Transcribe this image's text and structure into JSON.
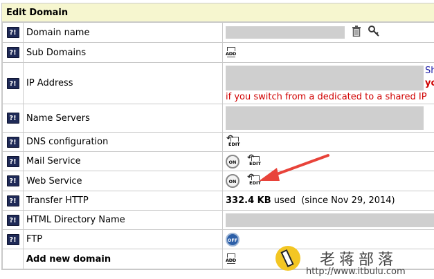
{
  "panel": {
    "title": "Edit Domain"
  },
  "help_label": "?!",
  "rows": {
    "domain_name": {
      "label": "Domain name"
    },
    "sub_domains": {
      "label": "Sub Domains",
      "icon_text": "ADD"
    },
    "ip_address": {
      "label": "IP Address",
      "side_text_1": "Sha",
      "side_text_2": "you",
      "warning": "if you switch from a dedicated to a shared IP"
    },
    "name_servers": {
      "label": "Name Servers"
    },
    "dns": {
      "label": "DNS configuration",
      "icon_text": "EDIT"
    },
    "mail": {
      "label": "Mail Service",
      "toggle": "ON",
      "icon_text": "EDIT"
    },
    "web": {
      "label": "Web Service",
      "toggle": "ON",
      "icon_text": "EDIT"
    },
    "transfer": {
      "label": "Transfer HTTP",
      "amount": "332.4 KB",
      "used": "used",
      "since": "(since Nov 29, 2014)"
    },
    "html_dir": {
      "label": "HTML Directory Name"
    },
    "ftp": {
      "label": "FTP",
      "toggle": "OFF"
    },
    "add_domain": {
      "label": "Add new domain",
      "icon_text": "ADD"
    }
  },
  "watermark": {
    "title": "老蒋部落",
    "url": "http://www.itbulu.com"
  },
  "colors": {
    "header_bg": "#f6f6cf",
    "help_bg": "#1f2a57",
    "warning": "#d00000",
    "annotation_arrow": "#e8433a"
  }
}
